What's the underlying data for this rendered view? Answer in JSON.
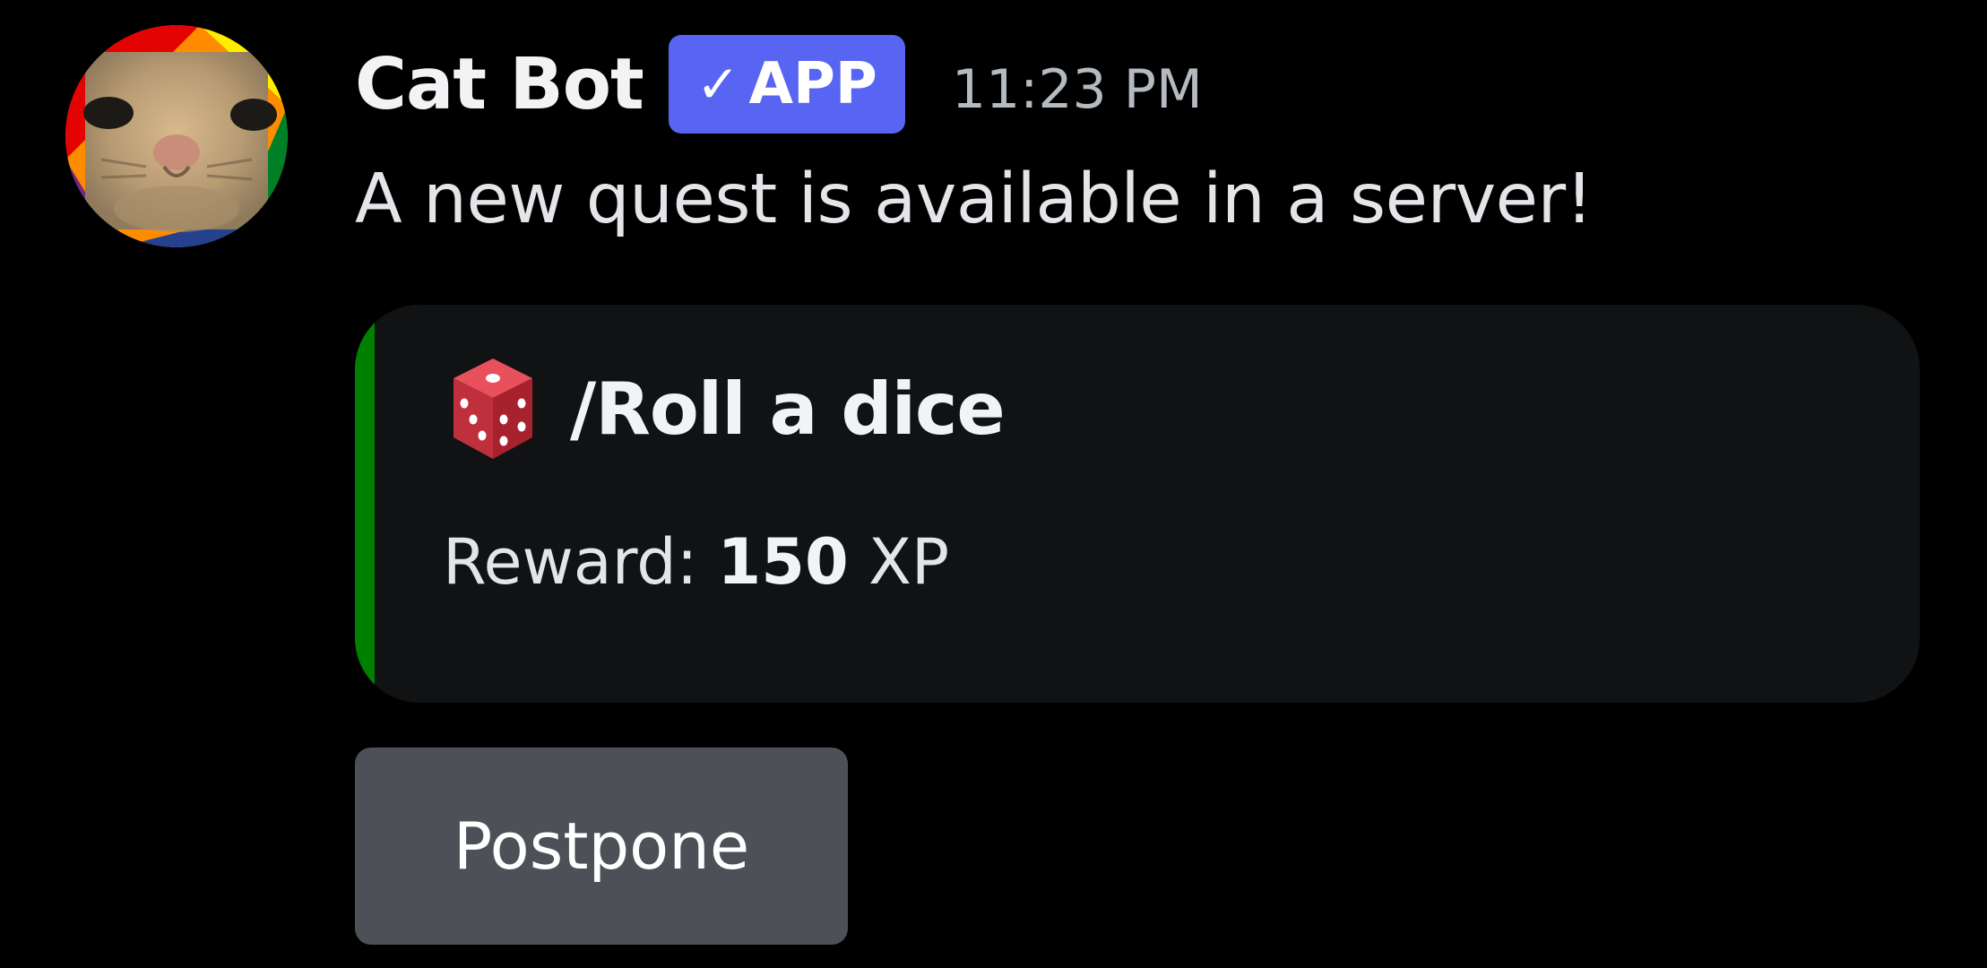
{
  "message": {
    "author": "Cat Bot",
    "badge": {
      "check": "✓",
      "label": "APP",
      "color": "#5865f2"
    },
    "timestamp": "11:23 PM",
    "text": "A new quest is available in a server!",
    "avatar_icon": "cat-face-avatar with rainbow ring"
  },
  "embed": {
    "accent_color": "#008000",
    "icon": "game-die-icon",
    "title": "/Roll a dice",
    "reward_label": "Reward:",
    "reward_value": "150",
    "reward_unit": "XP"
  },
  "buttons": {
    "postpone_label": "Postpone"
  }
}
